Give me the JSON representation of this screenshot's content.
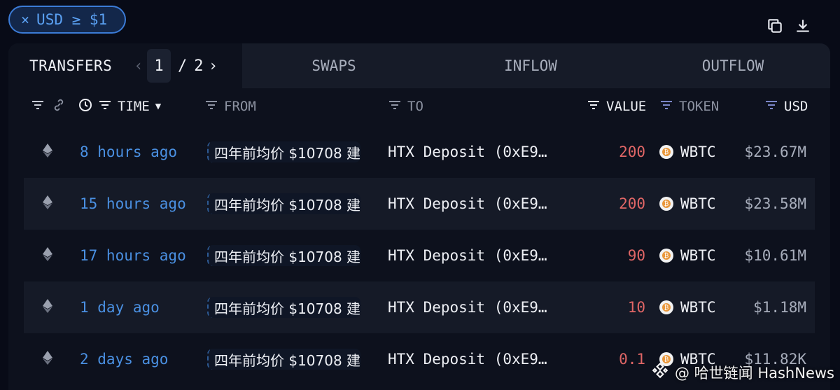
{
  "filter": {
    "close_symbol": "×",
    "label": "USD ≥ $1"
  },
  "toolbar": {
    "copy_icon": "copy-icon",
    "download_icon": "download-icon"
  },
  "tabs": {
    "active": "TRANSFERS",
    "pager": {
      "current": "1",
      "separator": "/",
      "total": "2"
    },
    "others": [
      "SWAPS",
      "INFLOW",
      "OUTFLOW"
    ]
  },
  "columns": {
    "time": "TIME",
    "from": "FROM",
    "to": "TO",
    "value": "VALUE",
    "token": "TOKEN",
    "usd": "USD"
  },
  "rows": [
    {
      "time": "8 hours ago",
      "from": "四年前均价 $10708 建",
      "to": "HTX Deposit (0xE9…",
      "value": "200",
      "token": "WBTC",
      "usd": "$23.67M"
    },
    {
      "time": "15 hours ago",
      "from": "四年前均价 $10708 建",
      "to": "HTX Deposit (0xE9…",
      "value": "200",
      "token": "WBTC",
      "usd": "$23.58M"
    },
    {
      "time": "17 hours ago",
      "from": "四年前均价 $10708 建",
      "to": "HTX Deposit (0xE9…",
      "value": "90",
      "token": "WBTC",
      "usd": "$10.61M"
    },
    {
      "time": "1 day ago",
      "from": "四年前均价 $10708 建",
      "to": "HTX Deposit (0xE9…",
      "value": "10",
      "token": "WBTC",
      "usd": "$1.18M"
    },
    {
      "time": "2 days ago",
      "from": "四年前均价 $10708 建",
      "to": "HTX Deposit (0xE9…",
      "value": "0.1",
      "token": "WBTC",
      "usd": "$11.82K"
    }
  ],
  "colors": {
    "accent": "#4a90e2",
    "value_red": "#e06666",
    "background": "#080b17"
  },
  "watermark": {
    "text": "@ 哈世链闻 HashNews"
  }
}
